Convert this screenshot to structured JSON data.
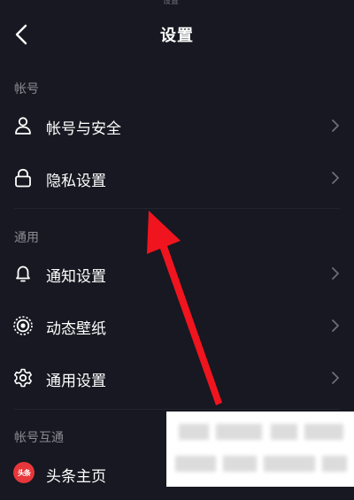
{
  "status_fragment": "设置",
  "header": {
    "title": "设置",
    "back_icon": "chevron-left-icon"
  },
  "sections": [
    {
      "title": "帐号",
      "items": [
        {
          "label": "帐号与安全",
          "icon": "user-icon"
        },
        {
          "label": "隐私设置",
          "icon": "lock-icon"
        }
      ]
    },
    {
      "title": "通用",
      "items": [
        {
          "label": "通知设置",
          "icon": "bell-icon"
        },
        {
          "label": "动态壁纸",
          "icon": "dynamic-wallpaper-icon"
        },
        {
          "label": "通用设置",
          "icon": "gear-icon"
        }
      ]
    },
    {
      "title": "帐号互通",
      "items": [
        {
          "label": "头条主页",
          "icon": "toutiao-logo-icon",
          "logo_text": "头条"
        }
      ]
    }
  ],
  "colors": {
    "background": "#171821",
    "section_title": "#8b8c93",
    "chevron": "#6c6d75",
    "annotation_arrow": "#f0141e",
    "toutiao_brand": "#e7373b"
  }
}
